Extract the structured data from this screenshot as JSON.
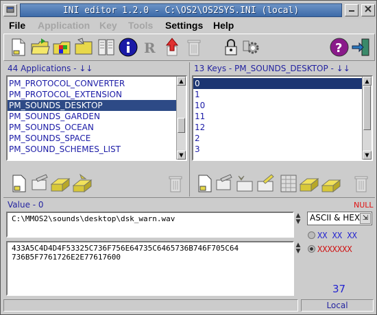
{
  "window": {
    "title": "INI editor 1.2.0 - C:\\OS2\\OS2SYS.INI (local)"
  },
  "menu": [
    {
      "label": "File",
      "enabled": true
    },
    {
      "label": "Application",
      "enabled": false
    },
    {
      "label": "Key",
      "enabled": false
    },
    {
      "label": "Tools",
      "enabled": false
    },
    {
      "label": "Settings",
      "enabled": true
    },
    {
      "label": "Help",
      "enabled": true
    }
  ],
  "apps": {
    "header": "44 Applications - ↓↓",
    "items": [
      "PM_PROTOCOL_CONVERTER",
      "PM_PROTOCOL_EXTENSION",
      "PM_SOUNDS_DESKTOP",
      "PM_SOUNDS_GARDEN",
      "PM_SOUNDS_OCEAN",
      "PM_SOUNDS_SPACE",
      "PM_SOUND_SCHEMES_LIST"
    ],
    "selected": "PM_SOUNDS_DESKTOP"
  },
  "keys": {
    "header": "13 Keys - PM_SOUNDS_DESKTOP - ↓↓",
    "items": [
      "0",
      "1",
      "10",
      "11",
      "12",
      "2",
      "3"
    ],
    "selected": "0"
  },
  "value": {
    "header": "Value - 0",
    "null_label": "NULL",
    "ascii_text": "C:\\MMOS2\\sounds\\desktop\\dsk_warn.wav",
    "hex_text": "433A5C4D4D4F53325C736F756E64735C6465736B746F705C64\n736B5F7761726E2E77617600",
    "format_select": "ASCII & HEX",
    "radio_hex": "XX XX XX",
    "radio_raw": "XXXXXXX",
    "length": "37"
  },
  "status": {
    "left": "",
    "right": "Local"
  },
  "colors": {
    "selection": "#2d4a86",
    "list_text": "#1a1aa6",
    "title_bar": "#3c6aa8",
    "null_red": "#e01010"
  }
}
